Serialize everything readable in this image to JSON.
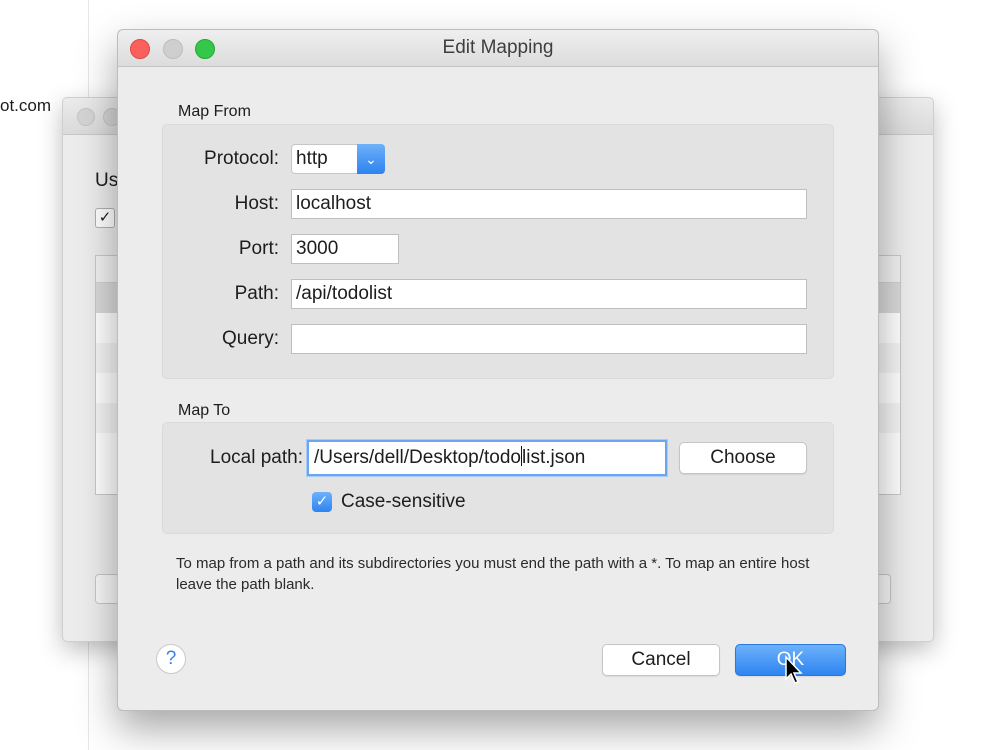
{
  "background": {
    "url_fragment": "ot.com",
    "partial_label": "Us"
  },
  "dialog": {
    "title": "Edit Mapping",
    "map_from": {
      "section_label": "Map From",
      "protocol_label": "Protocol:",
      "protocol_value": "http",
      "host_label": "Host:",
      "host_value": "localhost",
      "port_label": "Port:",
      "port_value": "3000",
      "path_label": "Path:",
      "path_value": "/api/todolist",
      "query_label": "Query:",
      "query_value": ""
    },
    "map_to": {
      "section_label": "Map To",
      "local_path_label": "Local path:",
      "local_path_value_before_caret": "/Users/dell/Desktop/todo",
      "local_path_value_after_caret": "list.json",
      "choose_button": "Choose",
      "case_sensitive_label": "Case-sensitive",
      "case_sensitive_checked": true
    },
    "hint_text": "To map from a path and its subdirectories you must end the path with a *. To map an entire host leave the path blank.",
    "help_button": "?",
    "cancel_button": "Cancel",
    "ok_button": "OK"
  },
  "colors": {
    "accent": "#2f84f1",
    "close": "#fc605c",
    "zoom": "#34c84a"
  }
}
